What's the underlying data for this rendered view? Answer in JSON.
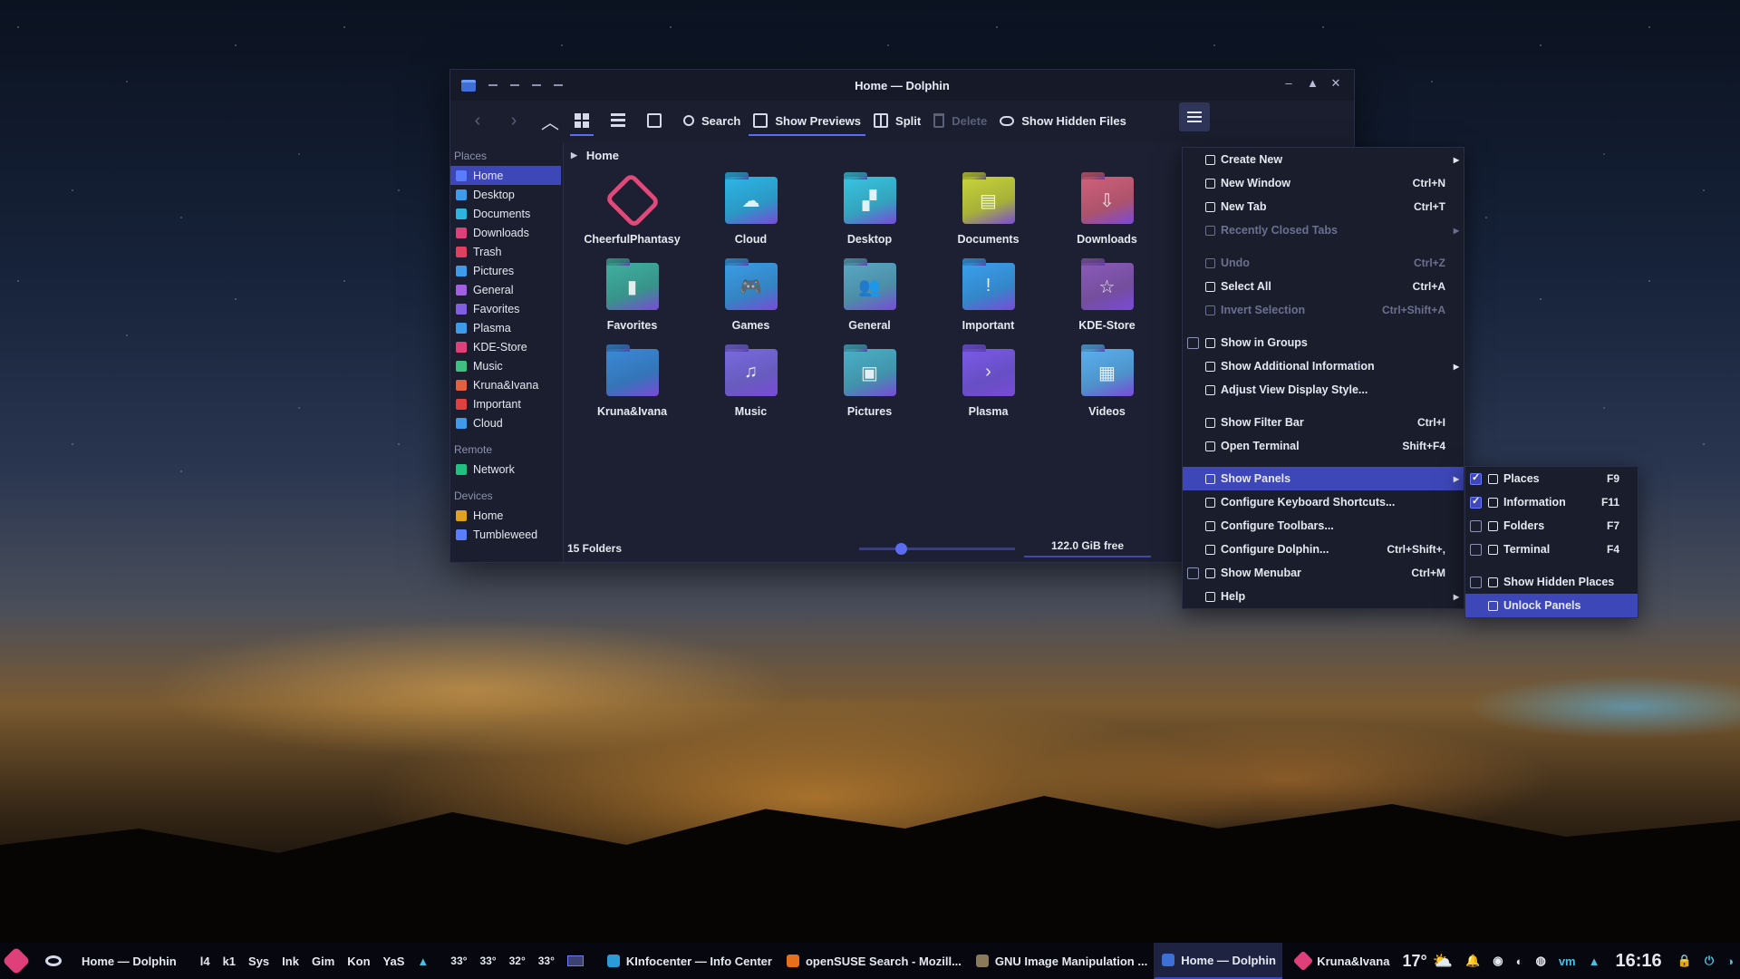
{
  "window": {
    "title": "Home — Dolphin",
    "controls": [
      "–",
      "▲",
      "✕"
    ]
  },
  "toolbar": {
    "search": "Search",
    "show_previews": "Show Previews",
    "split": "Split",
    "delete": "Delete",
    "show_hidden": "Show Hidden Files"
  },
  "sidebar": {
    "places_heading": "Places",
    "places": [
      {
        "label": "Home",
        "color": "#5a7cff"
      },
      {
        "label": "Desktop",
        "color": "#3d9be9"
      },
      {
        "label": "Documents",
        "color": "#2fb4e0"
      },
      {
        "label": "Downloads",
        "color": "#e0407a"
      },
      {
        "label": "Trash",
        "color": "#e04060"
      },
      {
        "label": "Pictures",
        "color": "#3d9be9"
      },
      {
        "label": "General",
        "color": "#a060e0"
      },
      {
        "label": "Favorites",
        "color": "#8060e0"
      },
      {
        "label": "Plasma",
        "color": "#3d9be9"
      },
      {
        "label": "KDE-Store",
        "color": "#e0407a"
      },
      {
        "label": "Music",
        "color": "#40c080"
      },
      {
        "label": "Kruna&Ivana",
        "color": "#e06040"
      },
      {
        "label": "Important",
        "color": "#e04040"
      },
      {
        "label": "Cloud",
        "color": "#3d9be9"
      }
    ],
    "remote_heading": "Remote",
    "remote": [
      {
        "label": "Network",
        "color": "#20c080"
      }
    ],
    "devices_heading": "Devices",
    "devices": [
      {
        "label": "Home",
        "color": "#e0a020"
      },
      {
        "label": "Tumbleweed",
        "color": "#5a7cff"
      }
    ]
  },
  "breadcrumb": "Home",
  "folders": [
    {
      "name": "CheerfulPhantasy",
      "color": "#e04a7a",
      "glyph": "◈"
    },
    {
      "name": "Cloud",
      "color": "#2eb6e8",
      "glyph": "☁"
    },
    {
      "name": "Desktop",
      "color": "#39c4e0",
      "glyph": "▞"
    },
    {
      "name": "Documents",
      "color": "#c8d43a",
      "glyph": "▤"
    },
    {
      "name": "Downloads",
      "color": "#d0607a",
      "glyph": "⇩"
    },
    {
      "name": "Favorites",
      "color": "#3fb0a0",
      "glyph": "▮"
    },
    {
      "name": "Games",
      "color": "#3a9de6",
      "glyph": "🎮"
    },
    {
      "name": "General",
      "color": "#58a8c4",
      "glyph": "👥"
    },
    {
      "name": "Important",
      "color": "#3aa0ee",
      "glyph": "!"
    },
    {
      "name": "KDE-Store",
      "color": "#8a5ab8",
      "glyph": "☆"
    },
    {
      "name": "Kruna&Ivana",
      "color": "#3a8ad8",
      "glyph": ""
    },
    {
      "name": "Music",
      "color": "#7a6ae0",
      "glyph": "♫"
    },
    {
      "name": "Pictures",
      "color": "#4ab0c8",
      "glyph": "▣"
    },
    {
      "name": "Plasma",
      "color": "#7a5ae8",
      "glyph": "›"
    },
    {
      "name": "Videos",
      "color": "#5ab0f0",
      "glyph": "▦"
    }
  ],
  "status": {
    "count": "15 Folders",
    "free": "122.0 GiB free",
    "zoom_fraction": 0.27
  },
  "menu": {
    "items": [
      {
        "label": "Create New",
        "shortcut": "",
        "sub": true,
        "disabled": false,
        "check": null
      },
      {
        "label": "New Window",
        "shortcut": "Ctrl+N",
        "sub": false,
        "disabled": false,
        "check": null
      },
      {
        "label": "New Tab",
        "shortcut": "Ctrl+T",
        "sub": false,
        "disabled": false,
        "check": null
      },
      {
        "label": "Recently Closed Tabs",
        "shortcut": "",
        "sub": true,
        "disabled": true,
        "check": null
      },
      {
        "sep": true
      },
      {
        "label": "Undo",
        "shortcut": "Ctrl+Z",
        "sub": false,
        "disabled": true,
        "check": null
      },
      {
        "label": "Select All",
        "shortcut": "Ctrl+A",
        "sub": false,
        "disabled": false,
        "check": null
      },
      {
        "label": "Invert Selection",
        "shortcut": "Ctrl+Shift+A",
        "sub": false,
        "disabled": true,
        "check": null
      },
      {
        "sep": true
      },
      {
        "label": "Show in Groups",
        "shortcut": "",
        "sub": false,
        "disabled": false,
        "check": false
      },
      {
        "label": "Show Additional Information",
        "shortcut": "",
        "sub": true,
        "disabled": false,
        "check": null
      },
      {
        "label": "Adjust View Display Style...",
        "shortcut": "",
        "sub": false,
        "disabled": false,
        "check": null
      },
      {
        "sep": true
      },
      {
        "label": "Show Filter Bar",
        "shortcut": "Ctrl+I",
        "sub": false,
        "disabled": false,
        "check": null
      },
      {
        "label": "Open Terminal",
        "shortcut": "Shift+F4",
        "sub": false,
        "disabled": false,
        "check": null
      },
      {
        "sep": true
      },
      {
        "label": "Show Panels",
        "shortcut": "",
        "sub": true,
        "disabled": false,
        "check": null,
        "highlight": true
      },
      {
        "label": "Configure Keyboard Shortcuts...",
        "shortcut": "",
        "sub": false,
        "disabled": false,
        "check": null
      },
      {
        "label": "Configure Toolbars...",
        "shortcut": "",
        "sub": false,
        "disabled": false,
        "check": null
      },
      {
        "label": "Configure Dolphin...",
        "shortcut": "Ctrl+Shift+,",
        "sub": false,
        "disabled": false,
        "check": null
      },
      {
        "label": "Show Menubar",
        "shortcut": "Ctrl+M",
        "sub": false,
        "disabled": false,
        "check": false
      },
      {
        "label": "Help",
        "shortcut": "",
        "sub": true,
        "disabled": false,
        "check": null
      }
    ]
  },
  "panels_menu": {
    "items": [
      {
        "label": "Places",
        "shortcut": "F9",
        "check": true
      },
      {
        "label": "Information",
        "shortcut": "F11",
        "check": true
      },
      {
        "label": "Folders",
        "shortcut": "F7",
        "check": false
      },
      {
        "label": "Terminal",
        "shortcut": "F4",
        "check": false
      },
      {
        "sep": true
      },
      {
        "label": "Show Hidden Places",
        "shortcut": "",
        "check": false
      },
      {
        "label": "Unlock Panels",
        "shortcut": "",
        "check": null,
        "highlight": true
      }
    ]
  },
  "taskbar": {
    "active_title": "Home — Dolphin",
    "launchers": [
      "l4",
      "k1",
      "Sys",
      "Ink",
      "Gim",
      "Kon",
      "YaS"
    ],
    "temps": [
      "33°",
      "33°",
      "32°",
      "33°"
    ],
    "tasks": [
      {
        "label": "KInfocenter — Info Center",
        "color": "#2a9ad8"
      },
      {
        "label": "openSUSE Search - Mozill...",
        "color": "#e8701a"
      },
      {
        "label": "GNU Image Manipulation ...",
        "color": "#8a7a5a"
      },
      {
        "label": "Home — Dolphin",
        "color": "#3d6fd6"
      }
    ],
    "user": "Kruna&Ivana",
    "weather": "17°",
    "clock": "16:16"
  }
}
